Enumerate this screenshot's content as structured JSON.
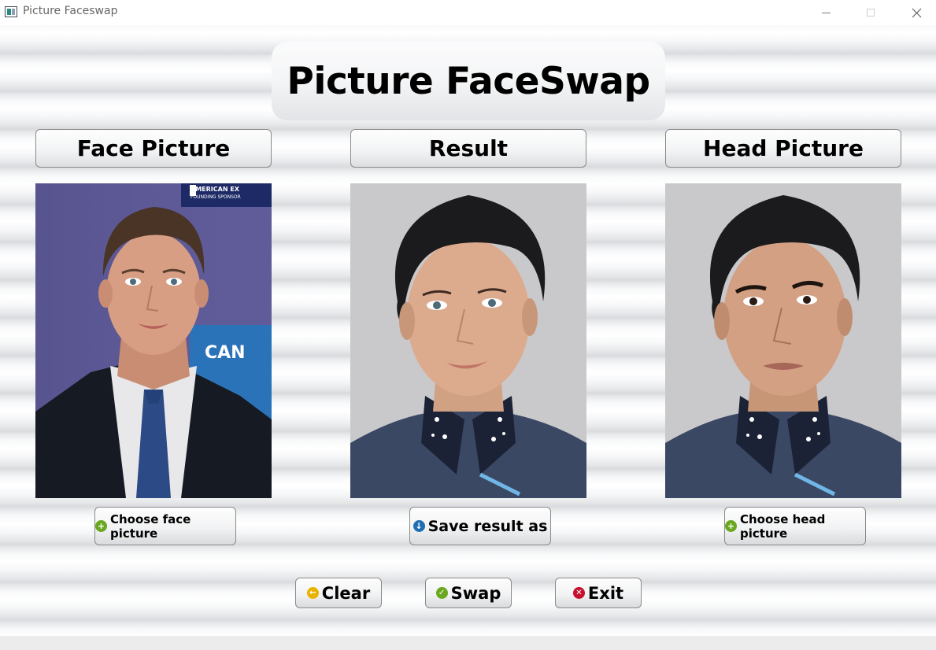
{
  "window": {
    "title": "Picture Faceswap"
  },
  "header": {
    "title": "Picture FaceSwap"
  },
  "columns": {
    "face": {
      "label": "Face Picture",
      "button": "Choose face picture",
      "icon": "plus-circle-icon",
      "icon_color": "#6aa820"
    },
    "result": {
      "label": "Result",
      "button": "Save result as",
      "icon": "download-circle-icon",
      "icon_color": "#1f6fb2"
    },
    "head": {
      "label": "Head Picture",
      "button": "Choose head picture",
      "icon": "plus-circle-icon",
      "icon_color": "#6aa820"
    }
  },
  "face_photo": {
    "backdrop_text_1": "AMERICAN EX",
    "backdrop_text_2": "FOUNDING SPONSOR",
    "backdrop_text_3": "CAN"
  },
  "actions": {
    "clear": {
      "label": "Clear",
      "icon": "arrow-circle-icon",
      "icon_color": "#e8b400"
    },
    "swap": {
      "label": "Swap",
      "icon": "check-circle-icon",
      "icon_color": "#6aa820"
    },
    "exit": {
      "label": "Exit",
      "icon": "x-circle-icon",
      "icon_color": "#c8102e"
    }
  },
  "colors": {
    "face_backdrop": "#5e5a96",
    "portrait_backdrop": "#c9c9cb",
    "sweater": "#3b4864"
  }
}
